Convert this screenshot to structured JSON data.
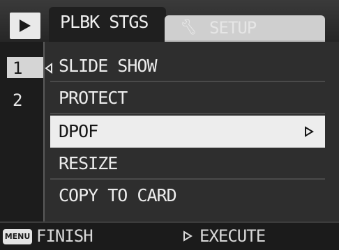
{
  "tabs": [
    {
      "label": "PLBK STGS",
      "active": true
    },
    {
      "label": "SETUP",
      "icon": "wrench-icon",
      "active": false
    }
  ],
  "pages": [
    "1",
    "2"
  ],
  "active_page": "1",
  "menu": {
    "items": [
      {
        "label": "SLIDE SHOW"
      },
      {
        "label": "PROTECT"
      },
      {
        "label": "DPOF",
        "selected": true
      },
      {
        "label": "RESIZE"
      },
      {
        "label": "COPY TO CARD"
      }
    ]
  },
  "footer": {
    "menu_badge": "MENU",
    "finish_label": "FINISH",
    "execute_label": "EXECUTE"
  },
  "colors": {
    "background": "#1d1d1d",
    "selected_row": "#ededed",
    "text": "#ececec"
  }
}
